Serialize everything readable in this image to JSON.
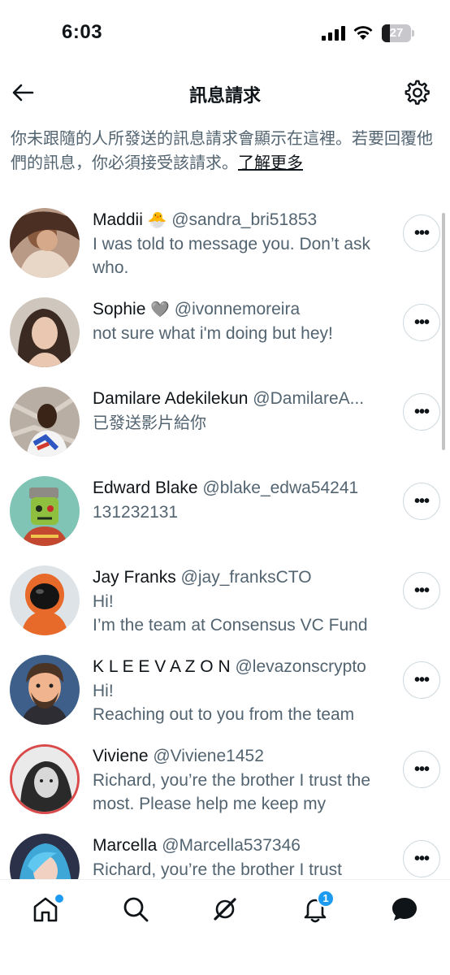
{
  "status_bar": {
    "time": "6:03",
    "battery": "27",
    "battery_level": 0.27
  },
  "header": {
    "title": "訊息請求",
    "back_icon": "arrow-left-icon",
    "settings_icon": "gear-icon"
  },
  "description": {
    "text": "你未跟隨的人所發送的訊息請求會顯示在這裡。若要回覆他們的訊息，你必須接受該請求。",
    "link": "了解更多"
  },
  "requests": [
    {
      "name": "Maddii",
      "emoji": "🐣",
      "handle": "@sandra_bri51853",
      "message": "I was told to message you. Don’t ask who."
    },
    {
      "name": "Sophie",
      "emoji": "🩶",
      "handle": "@ivonnemoreira",
      "message": "not sure what i'm doing but hey!"
    },
    {
      "name": "Damilare Adekilekun",
      "emoji": "",
      "handle": "@DamilareA...",
      "message": "已發送影片給你"
    },
    {
      "name": "Edward Blake",
      "emoji": "",
      "handle": "@blake_edwa54241",
      "message": "131232131"
    },
    {
      "name": "Jay Franks",
      "emoji": "",
      "handle": "@jay_franksCTO",
      "message": "Hi!\nI’m the team at Consensus VC Fund"
    },
    {
      "name": "K L E E V A Z O N",
      "emoji": "",
      "handle": "@levazonscrypto",
      "message": "Hi!\nReaching out to you from the team"
    },
    {
      "name": "Viviene",
      "emoji": "",
      "handle": "@Viviene1452",
      "message": "Richard, you’re the brother I trust the most. Please help me keep my"
    },
    {
      "name": "Marcella",
      "emoji": "",
      "handle": "@Marcella537346",
      "message": "Richard, you’re the brother I trust"
    }
  ],
  "more_label": "•••",
  "tab_bar": {
    "items": [
      "home-icon",
      "search-icon",
      "grok-icon",
      "notifications-icon",
      "messages-icon"
    ],
    "notification_count": "1"
  },
  "colors": {
    "accent": "#1d9bf0",
    "text": "#0f1419",
    "secondary": "#536471"
  }
}
